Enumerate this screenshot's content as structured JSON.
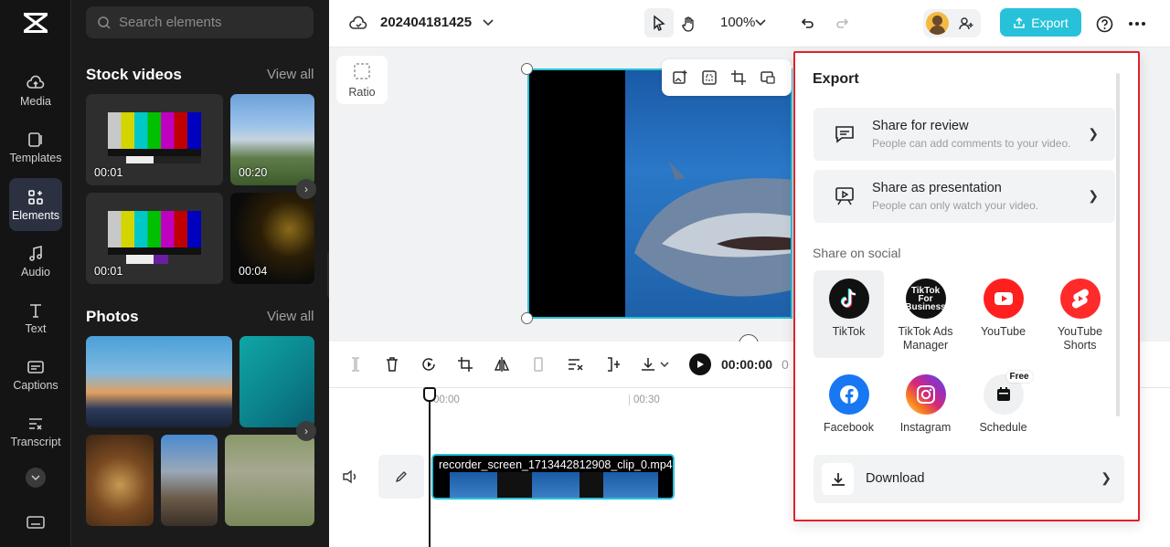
{
  "nav": {
    "items": [
      {
        "label": "Media",
        "icon": "cloud-upload-icon"
      },
      {
        "label": "Templates",
        "icon": "templates-icon"
      },
      {
        "label": "Elements",
        "icon": "elements-icon"
      },
      {
        "label": "Audio",
        "icon": "music-note-icon"
      },
      {
        "label": "Text",
        "icon": "text-icon"
      },
      {
        "label": "Captions",
        "icon": "captions-icon"
      },
      {
        "label": "Transcript",
        "icon": "transcript-icon"
      }
    ]
  },
  "panel": {
    "search_placeholder": "Search elements",
    "stock_title": "Stock videos",
    "photos_title": "Photos",
    "view_all": "View all",
    "videos": [
      {
        "duration": "00:01"
      },
      {
        "duration": "00:20"
      },
      {
        "duration": "00:01"
      },
      {
        "duration": "00:04"
      }
    ]
  },
  "topbar": {
    "project_name": "202404181425",
    "zoom": "100%",
    "export_label": "Export"
  },
  "canvas": {
    "ratio_label": "Ratio"
  },
  "timeline": {
    "time": "00:00:00",
    "time_sep": "0",
    "mark0": "00:00",
    "mark30": "00:30",
    "clip_name": "recorder_screen_1713442812908_clip_0.mp4"
  },
  "export_panel": {
    "title": "Export",
    "review_title": "Share for review",
    "review_sub": "People can add comments to your video.",
    "present_title": "Share as presentation",
    "present_sub": "People can only watch your video.",
    "social_heading": "Share on social",
    "social": [
      {
        "label": "TikTok",
        "icon": "tiktok-icon",
        "color": "#111111"
      },
      {
        "label": "TikTok Ads Manager",
        "icon": "tiktok-business-icon",
        "color": "#111111",
        "badge": "TikTok For Business"
      },
      {
        "label": "YouTube",
        "icon": "youtube-icon",
        "color": "#ff1f1f"
      },
      {
        "label": "YouTube Shorts",
        "icon": "youtube-shorts-icon",
        "color": "#ff2a2a"
      },
      {
        "label": "Facebook",
        "icon": "facebook-icon",
        "color": "#1877f2"
      },
      {
        "label": "Instagram",
        "icon": "instagram-icon",
        "color": "#d6249f"
      },
      {
        "label": "Schedule",
        "icon": "calendar-icon",
        "color": "#eef0f2",
        "badge": "Free"
      }
    ],
    "download_label": "Download"
  },
  "colors": {
    "accent": "#27c2d9",
    "highlight_border": "#e0212a"
  }
}
